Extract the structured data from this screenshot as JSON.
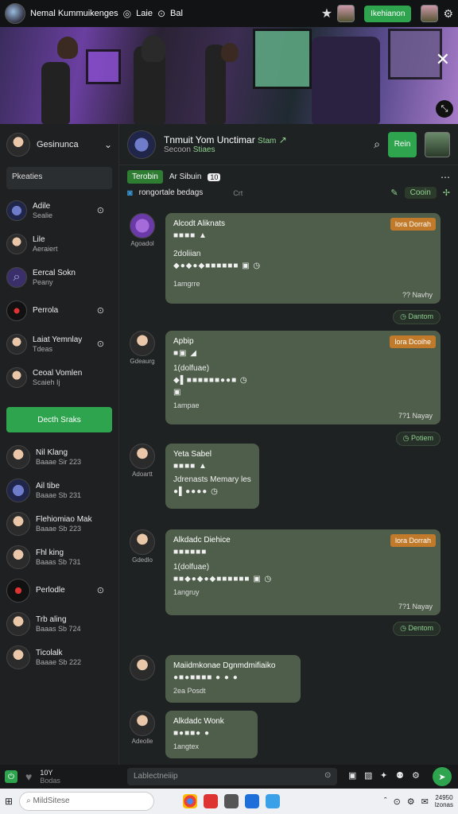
{
  "topbar": {
    "title": "Nemal Kummuikenges",
    "link1": "Laie",
    "link2": "Bal",
    "cta": "Ikehianon"
  },
  "sidebar": {
    "title": "Gesinunca",
    "search": "Pkeaties",
    "channels": [
      {
        "name": "Adile",
        "sub": "Sealie"
      },
      {
        "name": "Lile",
        "sub": "Aeraiert"
      },
      {
        "name": "Eercal Sokn",
        "sub": "Peany"
      },
      {
        "name": "Perrola",
        "sub": ""
      },
      {
        "name": "Laiat Yemnlay",
        "sub": "Tdeas"
      },
      {
        "name": "Ceoal Vomlen",
        "sub": "Scaieh Ij"
      }
    ],
    "action": "Decth Sraks",
    "dms": [
      {
        "name": "Nil Klang",
        "sub": "Baaae Sir 223"
      },
      {
        "name": "Ail tibe",
        "sub": "Baaae Sb 231"
      },
      {
        "name": "Flehiomiao Mak",
        "sub": "Baaae Sb 223"
      },
      {
        "name": "Fhl king",
        "sub": "Baaas Sb 731"
      },
      {
        "name": "Perlodle",
        "sub": ""
      },
      {
        "name": "Trb aling",
        "sub": "Baaas Sb 724"
      },
      {
        "name": "Ticolalk",
        "sub": "Baaae Sb 222"
      }
    ]
  },
  "chat": {
    "title": "Tnmuit Yom Unctimar",
    "title_suffix": "Stam",
    "subtitle": "Secoon",
    "subtitle2": "Stiaes",
    "head_btn": "Rein",
    "tag": "Terobin",
    "tag_text": "Ar Sibuin",
    "tag_count": "10",
    "info": "rongortale bedags",
    "info_hint": "Crt",
    "online_btn": "Cooin"
  },
  "messages": [
    {
      "avatar_label": "Agoadol",
      "name": "Alcodt Aliknats",
      "badge": "lora Dorrah",
      "line": "2doliian",
      "footer": "1amgrre",
      "time": "?? Navhy",
      "pill": "Dantom"
    },
    {
      "avatar_label": "Gdeaurg",
      "name": "Apbip",
      "badge": "lora Dcoihe",
      "line": "1(dolfuae)",
      "footer": "1ampae",
      "time": "7?1 Nayay",
      "pill": "Potiem"
    },
    {
      "avatar_label": "Adoartt",
      "name": "Yeta Sabel",
      "line": "Jdrenasts Memary les"
    },
    {
      "avatar_label": "Gdedlo",
      "name": "Alkdadc Diehice",
      "badge": "lora Dorrah",
      "line": "1(dolfuae)",
      "footer": "1angruy",
      "time": "7?1 Nayay",
      "pill": "Dentom"
    },
    {
      "avatar_label": "",
      "name": "Maiidmkonae Dgnmdmifiaiko",
      "footer": "2ea Posdt"
    },
    {
      "avatar_label": "Adeolle",
      "name": "Alkdadc Wonk",
      "footer": "1angtex"
    }
  ],
  "input": {
    "placeholder": "Lablectneiiip",
    "count": "10Y",
    "count_sub": "Bodas"
  },
  "taskbar": {
    "search": "MildSitese",
    "clock_time": "24950",
    "clock_date": "lzonas"
  }
}
